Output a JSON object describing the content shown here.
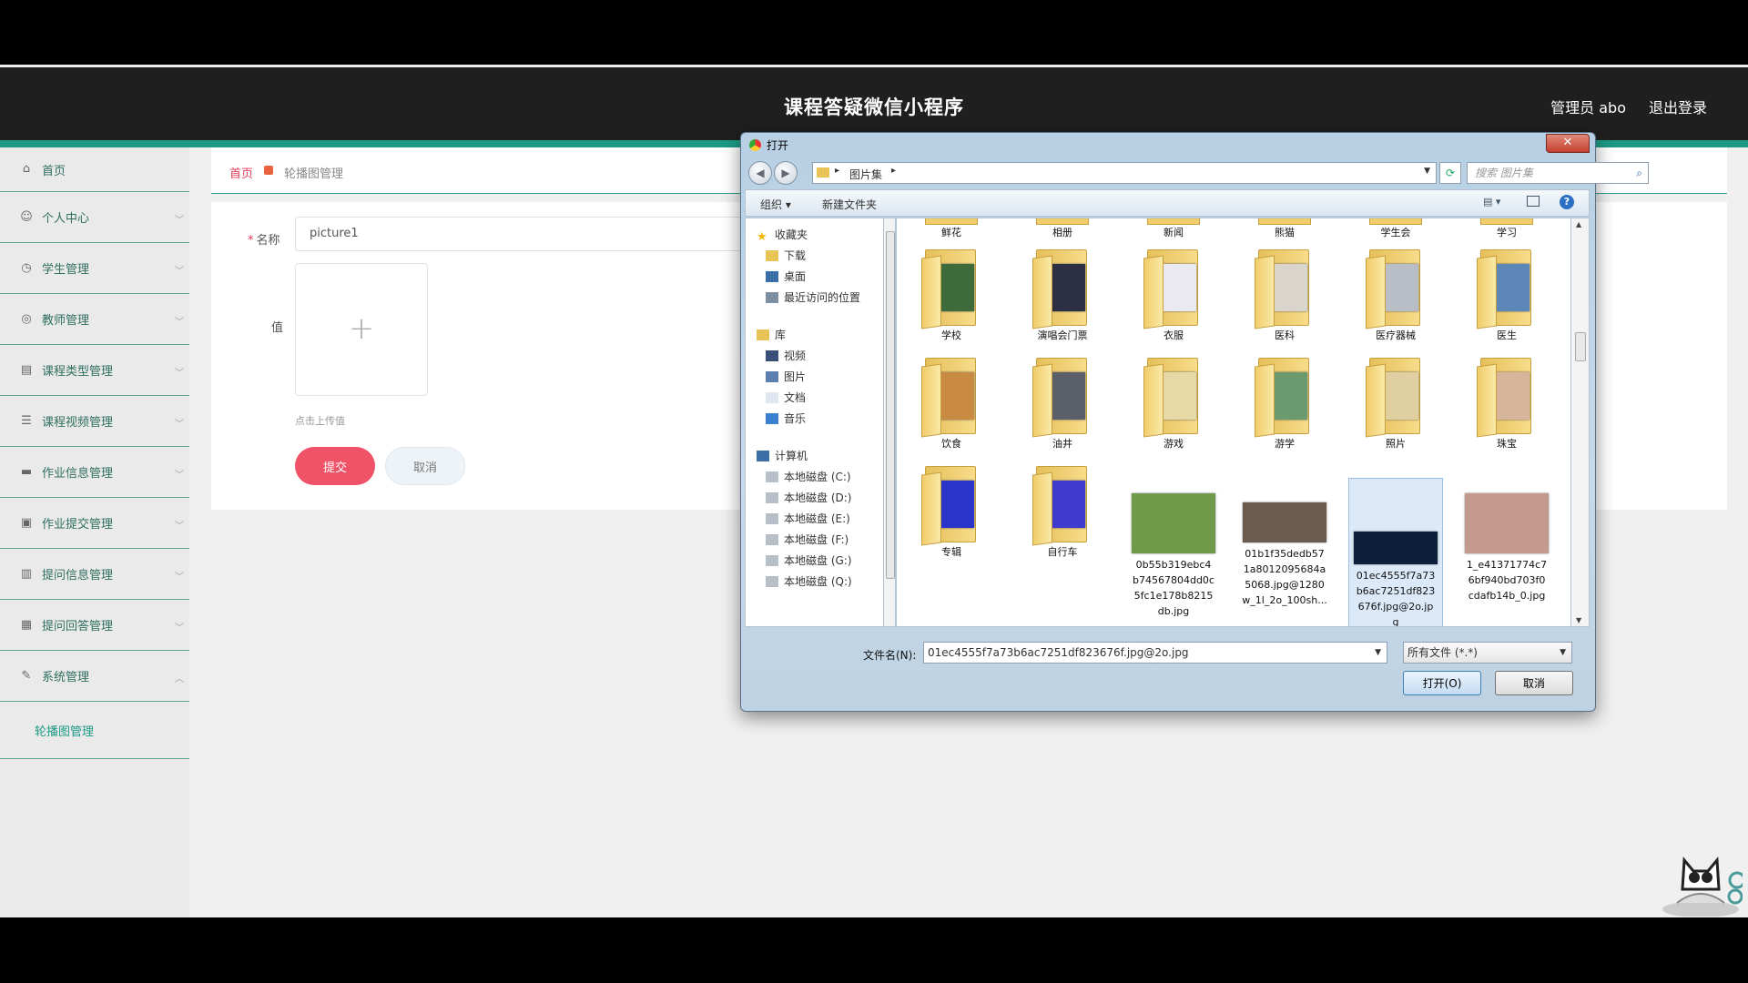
{
  "app": {
    "title": "课程答疑微信小程序",
    "admin_label": "管理员 abo",
    "logout_label": "退出登录"
  },
  "sidebar": {
    "items": [
      {
        "label": "首页",
        "icon": "home-icon"
      },
      {
        "label": "个人中心",
        "icon": "user-icon"
      },
      {
        "label": "学生管理",
        "icon": "clock-icon"
      },
      {
        "label": "教师管理",
        "icon": "circle-icon"
      },
      {
        "label": "课程类型管理",
        "icon": "clipboard-icon"
      },
      {
        "label": "课程视频管理",
        "icon": "list-icon"
      },
      {
        "label": "作业信息管理",
        "icon": "message-icon"
      },
      {
        "label": "作业提交管理",
        "icon": "folder-icon"
      },
      {
        "label": "提问信息管理",
        "icon": "bar-chart-icon"
      },
      {
        "label": "提问回答管理",
        "icon": "document-icon"
      },
      {
        "label": "系统管理",
        "icon": "settings-icon"
      }
    ],
    "sub_item": "轮播图管理"
  },
  "breadcrumb": {
    "home": "首页",
    "current": "轮播图管理"
  },
  "form": {
    "name_label": "名称",
    "name_value": "picture1",
    "value_label": "值",
    "upload_hint": "点击上传值",
    "submit_label": "提交",
    "cancel_label": "取消"
  },
  "dialog": {
    "title": "打开",
    "close": "✕",
    "address": "图片集",
    "search_placeholder": "搜索 图片集",
    "organize": "组织 ▾",
    "new_folder": "新建文件夹",
    "help": "?",
    "nav": [
      {
        "label": "收藏夹",
        "type": "header",
        "icon": "star-icon"
      },
      {
        "label": "下载",
        "type": "item",
        "icon": "download-folder-icon"
      },
      {
        "label": "桌面",
        "type": "item",
        "icon": "desktop-icon"
      },
      {
        "label": "最近访问的位置",
        "type": "item",
        "icon": "recent-places-icon"
      },
      {
        "label": "库",
        "type": "header",
        "icon": "library-icon"
      },
      {
        "label": "视频",
        "type": "item",
        "icon": "video-icon"
      },
      {
        "label": "图片",
        "type": "item",
        "icon": "pictures-icon"
      },
      {
        "label": "文档",
        "type": "item",
        "icon": "documents-icon"
      },
      {
        "label": "音乐",
        "type": "item",
        "icon": "music-icon"
      },
      {
        "label": "计算机",
        "type": "header",
        "icon": "computer-icon"
      },
      {
        "label": "本地磁盘 (C:)",
        "type": "item",
        "icon": "drive-icon"
      },
      {
        "label": "本地磁盘 (D:)",
        "type": "item",
        "icon": "drive-icon"
      },
      {
        "label": "本地磁盘 (E:)",
        "type": "item",
        "icon": "drive-icon"
      },
      {
        "label": "本地磁盘 (F:)",
        "type": "item",
        "icon": "drive-icon"
      },
      {
        "label": "本地磁盘 (G:)",
        "type": "item",
        "icon": "drive-icon"
      },
      {
        "label": "本地磁盘 (Q:)",
        "type": "item",
        "icon": "drive-icon"
      }
    ],
    "top_row": [
      "鲜花",
      "相册",
      "新闻",
      "熊猫",
      "学生会",
      "学习"
    ],
    "folders": [
      {
        "name": "学校",
        "color": "#3d6b3a"
      },
      {
        "name": "演唱会门票",
        "color": "#2d2f44"
      },
      {
        "name": "衣服",
        "color": "#e9e9ef"
      },
      {
        "name": "医科",
        "color": "#d9d4cc"
      },
      {
        "name": "医疗器械",
        "color": "#b9bec6"
      },
      {
        "name": "医生",
        "color": "#5d87b8"
      },
      {
        "name": "饮食",
        "color": "#c98a44"
      },
      {
        "name": "油井",
        "color": "#5a5f6a"
      },
      {
        "name": "游戏",
        "color": "#e7d9a6"
      },
      {
        "name": "游学",
        "color": "#6b9a6e"
      },
      {
        "name": "照片",
        "color": "#e0cfa1"
      },
      {
        "name": "珠宝",
        "color": "#d7b49c"
      },
      {
        "name": "专辑",
        "color": "#2a34c8"
      },
      {
        "name": "自行车",
        "color": "#3f3bcf"
      }
    ],
    "files": [
      {
        "name": "0b55b319ebc4b74567804dd0c5fc1e178b8215db.jpg",
        "lines": [
          "0b55b319ebc4",
          "b74567804dd0c",
          "5fc1e178b8215",
          "db.jpg"
        ],
        "color": "#6e9a4a",
        "selected": false
      },
      {
        "name": "01b1f35dedb571a80120956844a5068.jpg@1280w_1l_2o_100sh...",
        "lines": [
          "01b1f35dedb57",
          "1a8012095684a",
          "5068.jpg@1280",
          "w_1l_2o_100sh..."
        ],
        "color": "#6b5a4e",
        "selected": false
      },
      {
        "name": "01ec4555f7a73b6ac7251df823676f.jpg@2o.jpg",
        "lines": [
          "01ec4555f7a73",
          "b6ac7251df823",
          "676f.jpg@2o.jp",
          "g"
        ],
        "color": "#0e1f3c",
        "selected": true
      },
      {
        "name": "1_e41371774c76bf940bd703f0cdafb14b_0.jpg",
        "lines": [
          "1_e41371774c7",
          "6bf940bd703f0",
          "cdafb14b_0.jpg"
        ],
        "color": "#c49a8e",
        "selected": false
      }
    ],
    "filename_label": "文件名(N):",
    "filename_value": "01ec4555f7a73b6ac7251df823676f.jpg@2o.jpg",
    "filetype_value": "所有文件 (*.*)",
    "open_label": "打开(O)",
    "cancel_label": "取消"
  }
}
